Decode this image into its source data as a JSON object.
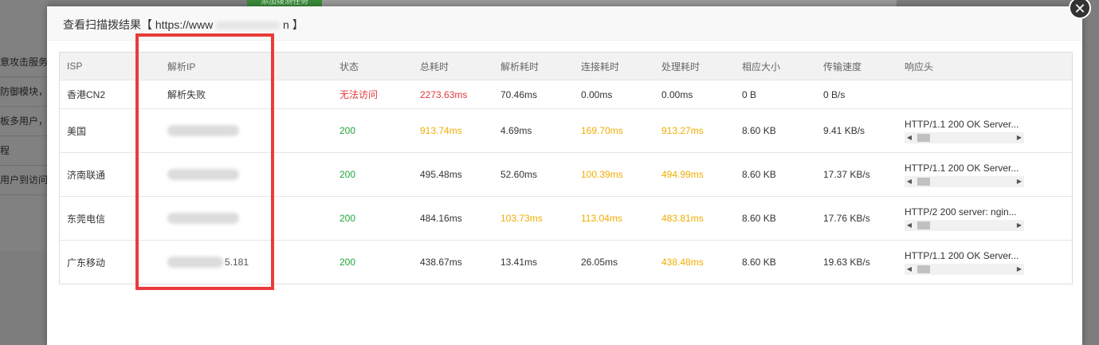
{
  "background": {
    "sidebar_lines": [
      "意攻击服务",
      "防御模块，",
      "板多用户，",
      "程",
      "用户到访问"
    ],
    "green_button": "添加拨测任务"
  },
  "modal": {
    "title_prefix": "查看扫描拨结果【 https://www",
    "title_mid": "...20K",
    "title_suffix": "n 】",
    "close_glyph": "✕"
  },
  "table": {
    "headers": [
      "ISP",
      "解析IP",
      "状态",
      "总耗时",
      "解析耗时",
      "连接耗时",
      "处理耗时",
      "相应大小",
      "传输速度",
      "响应头"
    ],
    "rows": [
      {
        "isp": "香港CN2",
        "ip": "解析失败",
        "ip_tail": "",
        "status": "无法访问",
        "total": "2273.63ms",
        "dns": "70.46ms",
        "connect": "0.00ms",
        "process": "0.00ms",
        "size": "0 B",
        "speed": "0 B/s",
        "header": ""
      },
      {
        "isp": "美国",
        "ip": "",
        "ip_tail": "",
        "status": "200",
        "total": "913.74ms",
        "dns": "4.69ms",
        "connect": "169.70ms",
        "process": "913.27ms",
        "size": "8.60 KB",
        "speed": "9.41 KB/s",
        "header": "HTTP/1.1 200 OK Server..."
      },
      {
        "isp": "济南联通",
        "ip": "",
        "ip_tail": "",
        "status": "200",
        "total": "495.48ms",
        "dns": "52.60ms",
        "connect": "100.39ms",
        "process": "494.99ms",
        "size": "8.60 KB",
        "speed": "17.37 KB/s",
        "header": "HTTP/1.1 200 OK Server..."
      },
      {
        "isp": "东莞电信",
        "ip": "",
        "ip_tail": "",
        "status": "200",
        "total": "484.16ms",
        "dns": "103.73ms",
        "connect": "113.04ms",
        "process": "483.81ms",
        "size": "8.60 KB",
        "speed": "17.76 KB/s",
        "header": "HTTP/2 200 server: ngin..."
      },
      {
        "isp": "广东移动",
        "ip": "",
        "ip_tail": "5.181",
        "status": "200",
        "total": "438.67ms",
        "dns": "13.41ms",
        "connect": "26.05ms",
        "process": "438.48ms",
        "size": "8.60 KB",
        "speed": "19.63 KB/s",
        "header": "HTTP/1.1 200 OK Server..."
      }
    ]
  },
  "colors": {
    "fail": "#e0393e",
    "ok": "#20a53a",
    "warn": "#f0ad00",
    "highlight_box": "#ea3b3b"
  }
}
